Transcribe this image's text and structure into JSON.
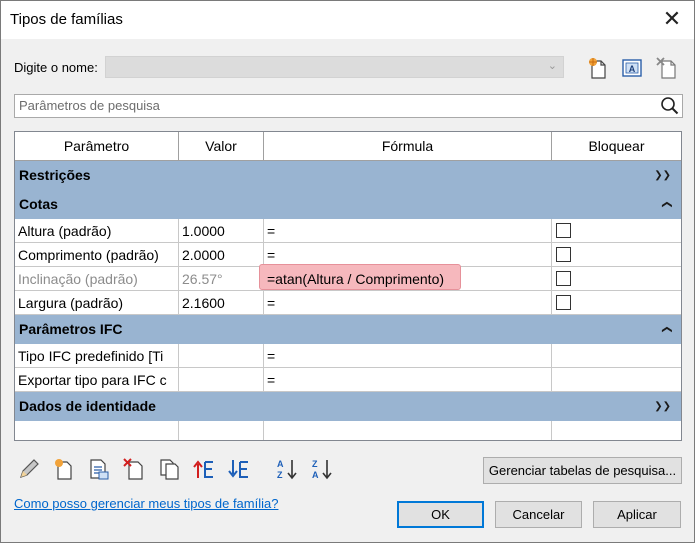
{
  "window": {
    "title": "Tipos de famílias"
  },
  "name_field": {
    "label": "Digite o nome:",
    "value": ""
  },
  "search": {
    "placeholder": "Parâmetros de pesquisa"
  },
  "table": {
    "columns": [
      "Parâmetro",
      "Valor",
      "Fórmula",
      "Bloquear"
    ],
    "groups": {
      "restricoes": "Restrições",
      "cotas": "Cotas",
      "ifc": "Parâmetros IFC",
      "identidade": "Dados de identidade"
    },
    "cotas_rows": [
      {
        "param": "Altura (padrão)",
        "value": "1.0000",
        "formula": "="
      },
      {
        "param": "Comprimento (padrão)",
        "value": "2.0000",
        "formula": "="
      },
      {
        "param": "Inclinação (padrão)",
        "value": "26.57°",
        "formula": "=atan(Altura / Comprimento)"
      },
      {
        "param": "Largura (padrão)",
        "value": "2.1600",
        "formula": "="
      }
    ],
    "ifc_rows": [
      {
        "param": "Tipo IFC predefinido [Ti",
        "value": "",
        "formula": "="
      },
      {
        "param": "Exportar tipo para IFC c",
        "value": "",
        "formula": "="
      }
    ]
  },
  "buttons": {
    "manage_lookup": "Gerenciar tabelas de pesquisa...",
    "ok": "OK",
    "cancel": "Cancelar",
    "apply": "Aplicar"
  },
  "help_link": "Como posso gerenciar meus tipos de família?",
  "icons": {
    "toolbar": [
      "new-type-icon",
      "rename-type-icon",
      "delete-type-icon"
    ],
    "bottom": [
      "edit-parameter-icon",
      "new-parameter-icon",
      "duplicate-parameter-icon",
      "delete-parameter-icon",
      "copy-icon",
      "move-up-icon",
      "move-down-icon",
      "sort-ascending-icon",
      "sort-descending-icon"
    ]
  }
}
